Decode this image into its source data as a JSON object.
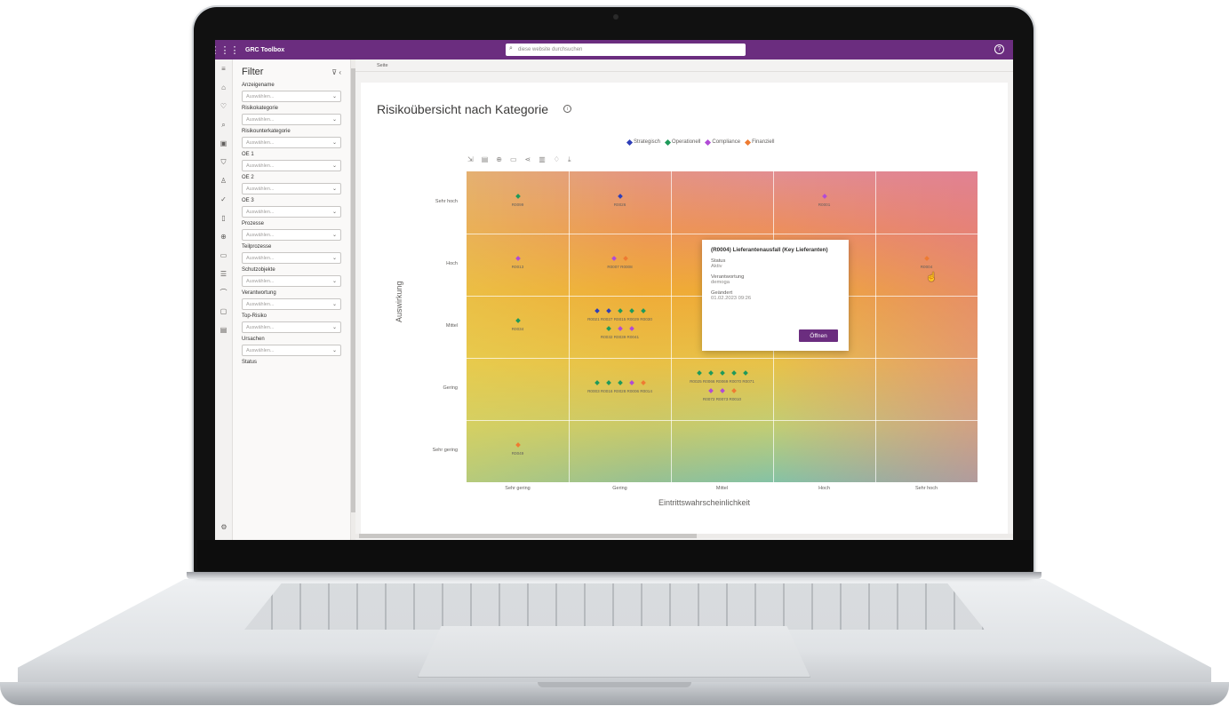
{
  "app": {
    "name": "GRC Toolbox",
    "search_placeholder": "diese website durchsuchen",
    "help_icon": "help-icon"
  },
  "rail_icons": [
    "menu-icon",
    "home-icon",
    "heart-icon",
    "search-icon",
    "dashboard-icon",
    "shield-icon",
    "person-icon",
    "check-circle-icon",
    "document-icon",
    "globe-icon",
    "folder-icon",
    "filter-list-icon",
    "wifi-icon",
    "file-icon",
    "report-icon",
    "settings-icon"
  ],
  "filter": {
    "title": "Filter",
    "fields": [
      {
        "label": "Anzeigename",
        "placeholder": "Auswählen..."
      },
      {
        "label": "Risikokategorie",
        "placeholder": "Auswählen..."
      },
      {
        "label": "Risikounterkategorie",
        "placeholder": "Auswählen..."
      },
      {
        "label": "OE 1",
        "placeholder": "Auswählen..."
      },
      {
        "label": "OE 2",
        "placeholder": "Auswählen..."
      },
      {
        "label": "OE 3",
        "placeholder": "Auswählen..."
      },
      {
        "label": "Prozesse",
        "placeholder": "Auswählen..."
      },
      {
        "label": "Teilprozesse",
        "placeholder": "Auswählen..."
      },
      {
        "label": "Schutzobjekte",
        "placeholder": "Auswählen..."
      },
      {
        "label": "Verantwortung",
        "placeholder": "Auswählen..."
      },
      {
        "label": "Top-Risiko",
        "placeholder": "Auswählen..."
      },
      {
        "label": "Ursachen",
        "placeholder": "Auswählen..."
      },
      {
        "label": "Status",
        "placeholder": ""
      }
    ]
  },
  "page_tab": "Seite",
  "report": {
    "title": "Risikoübersicht nach Kategorie"
  },
  "colors": {
    "Strategisch": "#2f3fb8",
    "Operationell": "#1f9a5a",
    "Compliance": "#b14bd6",
    "Finanziell": "#ee7b32",
    "brand": "#6b2d7f"
  },
  "chart_data": {
    "type": "scatter",
    "xlabel": "Eintrittswahrscheinlichkeit",
    "ylabel": "Auswirkung",
    "x_categories": [
      "Sehr gering",
      "Gering",
      "Mittel",
      "Hoch",
      "Sehr hoch"
    ],
    "y_categories": [
      "Sehr gering",
      "Gering",
      "Mittel",
      "Hoch",
      "Sehr hoch"
    ],
    "legend": [
      "Strategisch",
      "Operationell",
      "Compliance",
      "Finanziell"
    ],
    "legend_position": "top",
    "groups": [
      {
        "x": "Sehr gering",
        "y": "Sehr hoch",
        "rows": [
          {
            "cats": [
              "Operationell"
            ],
            "ids": "R0099"
          }
        ]
      },
      {
        "x": "Gering",
        "y": "Sehr hoch",
        "rows": [
          {
            "cats": [
              "Strategisch"
            ],
            "ids": "R0026"
          }
        ]
      },
      {
        "x": "Hoch",
        "y": "Sehr hoch",
        "rows": [
          {
            "cats": [
              "Compliance"
            ],
            "ids": "R0001"
          }
        ]
      },
      {
        "x": "Sehr gering",
        "y": "Hoch",
        "rows": [
          {
            "cats": [
              "Compliance"
            ],
            "ids": "R0013"
          }
        ]
      },
      {
        "x": "Gering",
        "y": "Hoch",
        "rows": [
          {
            "cats": [
              "Compliance",
              "Finanziell"
            ],
            "ids": "R0007 R0008"
          }
        ]
      },
      {
        "x": "Sehr hoch",
        "y": "Hoch",
        "rows": [
          {
            "cats": [
              "Finanziell"
            ],
            "ids": "R0004"
          }
        ]
      },
      {
        "x": "Sehr gering",
        "y": "Mittel",
        "rows": [
          {
            "cats": [
              "Operationell"
            ],
            "ids": "R0034"
          }
        ]
      },
      {
        "x": "Gering",
        "y": "Mittel",
        "rows": [
          {
            "cats": [
              "Strategisch",
              "Strategisch",
              "Operationell",
              "Operationell",
              "Operationell"
            ],
            "ids": "R0021 R0027 R0015 R0029 R0030"
          },
          {
            "cats": [
              "Operationell",
              "Compliance",
              "Compliance"
            ],
            "ids": "R0032 R0039 R0041"
          }
        ]
      },
      {
        "x": "Mittel",
        "y": "Mittel",
        "rows": [
          {
            "cats": [
              "Compliance",
              "Compliance"
            ],
            "ids": "R0023 R0040"
          }
        ]
      },
      {
        "x": "Hoch",
        "y": "Mittel",
        "rows": [
          {
            "cats": [
              "Operationell",
              "Operationell",
              "Operationell"
            ],
            "ids": "R0002 R0005 R0"
          }
        ]
      },
      {
        "x": "Gering",
        "y": "Gering",
        "rows": [
          {
            "cats": [
              "Operationell",
              "Operationell",
              "Operationell",
              "Compliance",
              "Finanziell"
            ],
            "ids": "R0003 R0016 R0028 R0006 R0014"
          }
        ]
      },
      {
        "x": "Mittel",
        "y": "Gering",
        "rows": [
          {
            "cats": [
              "Operationell",
              "Operationell",
              "Operationell",
              "Operationell",
              "Operationell"
            ],
            "ids": "R0025 R0066 R0069 R0070 R0071"
          },
          {
            "cats": [
              "Compliance",
              "Compliance",
              "Finanziell"
            ],
            "ids": "R0072 R0073 R0010"
          }
        ]
      },
      {
        "x": "Sehr gering",
        "y": "Sehr gering",
        "rows": [
          {
            "cats": [
              "Finanziell"
            ],
            "ids": "R0049"
          }
        ]
      }
    ]
  },
  "tooltip": {
    "title": "(R0004) Lieferantenausfall (Key Lieferanten)",
    "status_label": "Status",
    "status_value": "Aktiv",
    "owner_label": "Verantwortung",
    "owner_value": "demoga",
    "changed_label": "Geändert",
    "changed_value": "01.02.2023 09:26",
    "button": "Öffnen"
  }
}
